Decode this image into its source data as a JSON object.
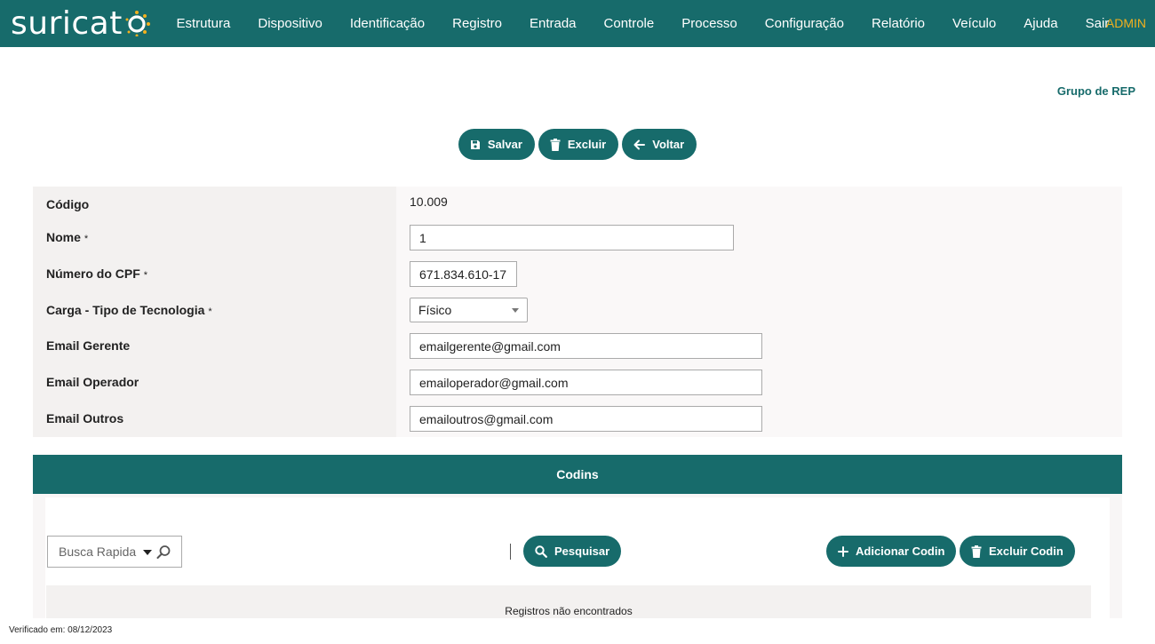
{
  "header": {
    "logo_text": "suricat",
    "nav": [
      "Estrutura",
      "Dispositivo",
      "Identificação",
      "Registro",
      "Entrada",
      "Controle",
      "Processo",
      "Configuração",
      "Relatório",
      "Veículo",
      "Ajuda",
      "Sair"
    ],
    "user": "ADMIN"
  },
  "page": {
    "title": "Grupo de REP"
  },
  "actions": {
    "save": "Salvar",
    "delete": "Excluir",
    "back": "Voltar"
  },
  "form": {
    "codigo_label": "Código",
    "codigo_value": "10.009",
    "nome_label": "Nome",
    "nome_value": "1",
    "cpf_label": "Número do CPF",
    "cpf_value": "671.834.610-17",
    "carga_label": "Carga - Tipo de Tecnologia",
    "carga_value": "Físico",
    "email_gerente_label": "Email Gerente",
    "email_gerente_value": "emailgerente@gmail.com",
    "email_operador_label": "Email Operador",
    "email_operador_value": "emailoperador@gmail.com",
    "email_outros_label": "Email Outros",
    "email_outros_value": "emailoutros@gmail.com",
    "required_mark": "*"
  },
  "codins": {
    "title": "Codins",
    "search_placeholder": "Busca Rapida",
    "search_button": "Pesquisar",
    "add_button": "Adicionar Codin",
    "delete_button": "Excluir Codin",
    "empty_message": "Registros não encontrados"
  },
  "footer": {
    "verified": "Verificado em: 08/12/2023"
  },
  "colors": {
    "primary": "#176b6b",
    "accent": "#f2b01e",
    "label_bg": "#f3f1f0"
  }
}
